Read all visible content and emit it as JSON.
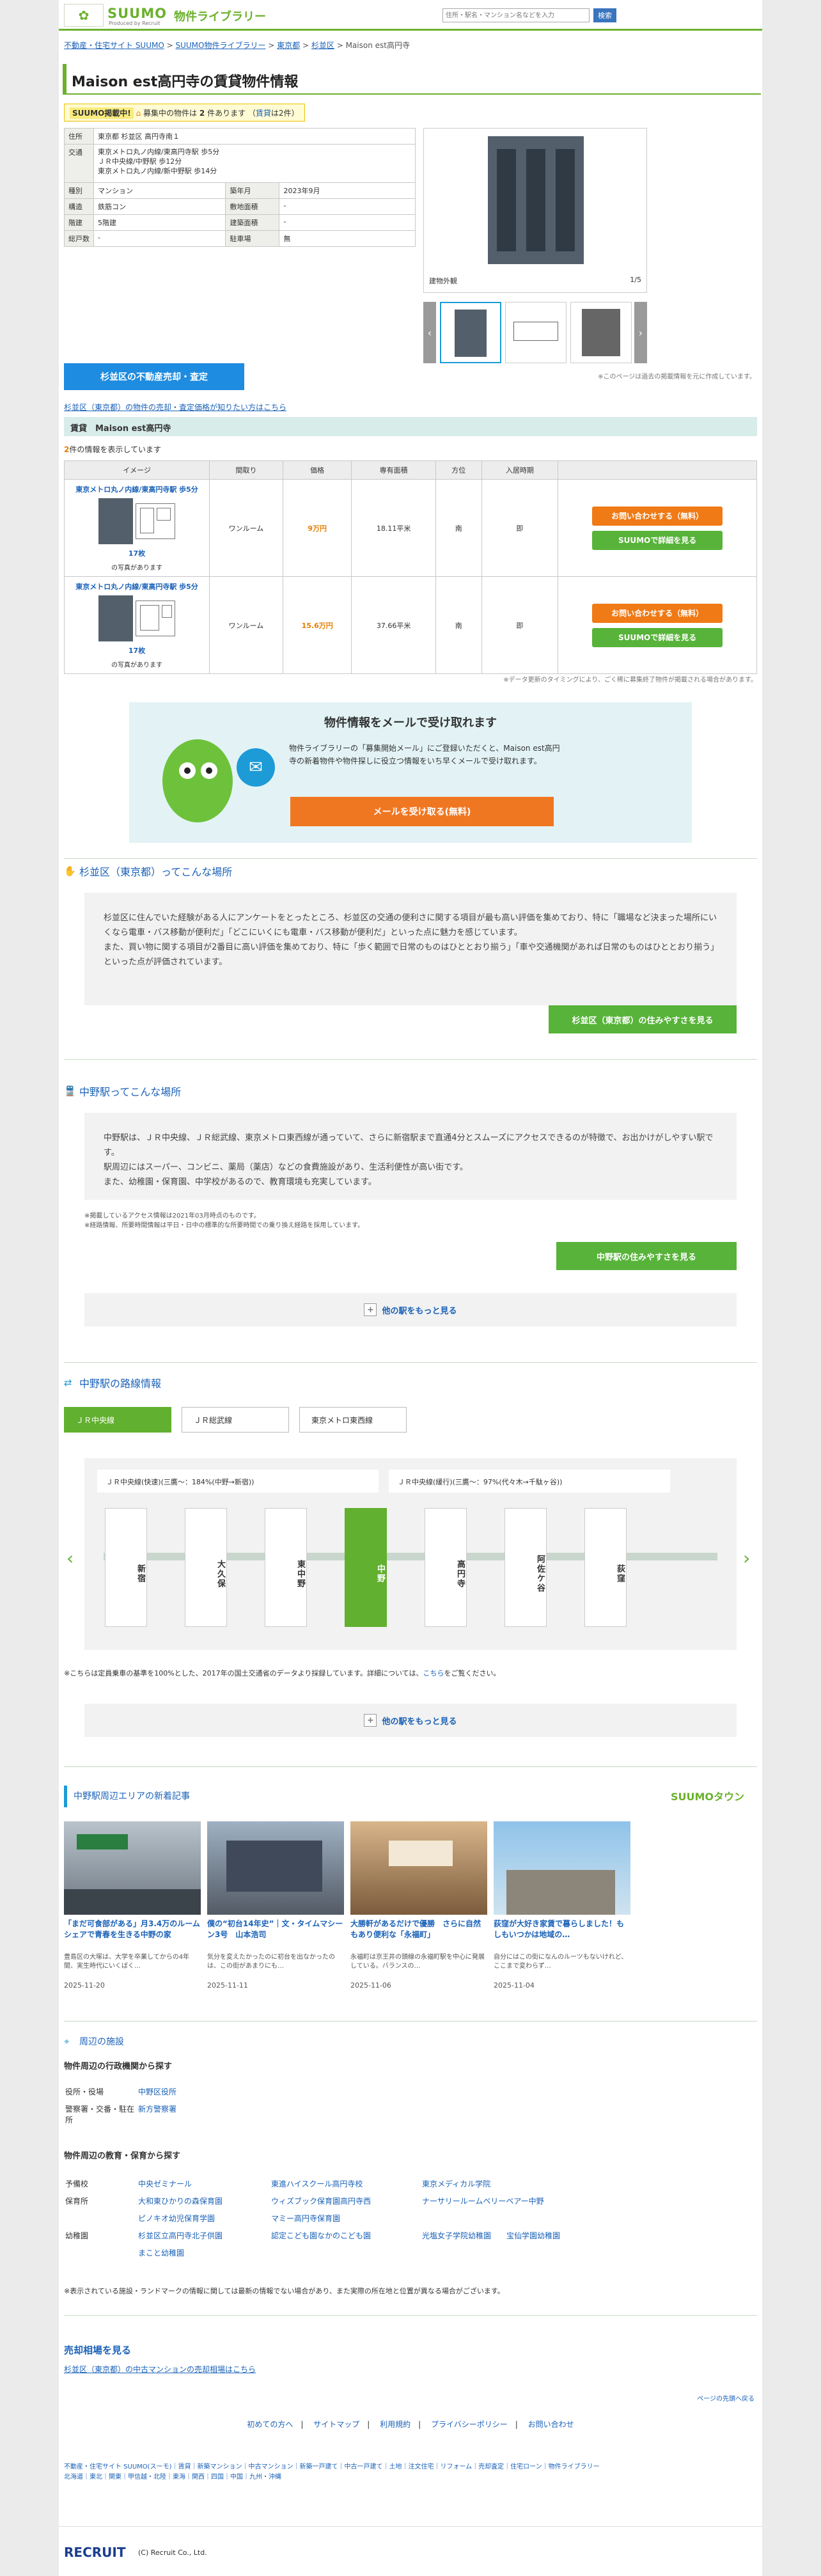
{
  "header": {
    "logo": "SUUMO",
    "logo_sub": "Produced by Recruit",
    "kind": "物件ライブラリー",
    "search_placeholder": "住所・駅名・マンション名などを入力",
    "search_button": "検索"
  },
  "breadcrumb": [
    "不動産・住宅サイト SUUMO",
    "SUUMO物件ライブラリー",
    "東京都",
    "杉並区",
    "Maison est高円寺"
  ],
  "title": "Maison est高円寺の賃貸物件情報",
  "badge": {
    "tag": "SUUMO掲載中!",
    "text1": "募集中の物件は",
    "count": "2",
    "text2": "件あります",
    "link": "賃貸",
    "link_suffix": "は2件"
  },
  "info": [
    {
      "label": "住所",
      "value": "東京都 杉並区 高円寺南１"
    },
    {
      "label": "交通",
      "value": "東京メトロ丸ノ内線/東高円寺駅 歩5分\nＪＲ中央線/中野駅 歩12分\n東京メトロ丸ノ内線/新中野駅 歩14分"
    }
  ],
  "info_grid": [
    {
      "l1": "種別",
      "v1": "マンション",
      "l2": "築年月",
      "v2": "2023年9月"
    },
    {
      "l1": "構造",
      "v1": "鉄筋コン",
      "l2": "敷地面積",
      "v2": "-"
    },
    {
      "l1": "階建",
      "v1": "5階建",
      "l2": "建築面積",
      "v2": "-"
    },
    {
      "l1": "総戸数",
      "v1": "-",
      "l2": "駐車場",
      "v2": "無"
    }
  ],
  "photo": {
    "caption": "建物外観",
    "count": "1/5"
  },
  "photo_note": "※このページは過去の掲載情報を元に作成しています。",
  "sell_button": "杉並区の不動産売却・査定",
  "sell_link": "杉並区（東京都）の物件の売却・査定価格が知りたい方はこちら",
  "rent": {
    "header": "賃貸　Maison est高円寺",
    "count_num": "2",
    "count_text": "件の情報を表示しています",
    "columns": [
      "イメージ",
      "間取り",
      "価格",
      "専有面積",
      "方位",
      "入居時期",
      ""
    ],
    "rows": [
      {
        "name": "東京メトロ丸ノ内線/東高円寺駅 歩5分",
        "pics": "17枚",
        "pics_suffix": "の写真があります",
        "layout": "ワンルーム",
        "price": "9万円",
        "area": "18.11平米",
        "dir": "南",
        "move": "即"
      },
      {
        "name": "東京メトロ丸ノ内線/東高円寺駅 歩5分",
        "pics": "17枚",
        "pics_suffix": "の写真があります",
        "layout": "ワンルーム",
        "price": "15.6万円",
        "area": "37.66平米",
        "dir": "南",
        "move": "即"
      }
    ],
    "btn_inquiry": "お問い合わせする（無料）",
    "btn_detail": "SUUMOで詳細を見る",
    "note": "※データ更新のタイミングにより、ごく稀に募集終了物件が掲載される場合があります。"
  },
  "mail": {
    "title": "物件情報をメールで受け取れます",
    "text": "物件ライブラリーの「募集開始メール」にご登録いただくと、Maison est高円寺の新着物件や物件探しに役立つ情報をいち早くメールで受け取れます。",
    "button": "メールを受け取る(無料)"
  },
  "area1": {
    "title": "杉並区（東京都）ってこんな場所",
    "text": "杉並区に住んでいた経験がある人にアンケートをとったところ、杉並区の交通の便利さに関する項目が最も高い評価を集めており、特に「職場など決まった場所にいくなら電車・バス移動が便利だ」「どこにいくにも電車・バス移動が便利だ」といった点に魅力を感じています。\nまた、買い物に関する項目が2番目に高い評価を集めており、特に「歩く範囲で日常のものはひととおり揃う」「車や交通機関があれば日常のものはひととおり揃う」といった点が評価されています。",
    "button": "杉並区（東京都）の住みやすさを見る"
  },
  "area2": {
    "title": "中野駅ってこんな場所",
    "text": "中野駅は、ＪＲ中央線、ＪＲ総武線、東京メトロ東西線が通っていて、さらに新宿駅まで直通4分とスムーズにアクセスできるのが特徴で、お出かけがしやすい駅です。\n駅周辺にはスーパー、コンビニ、薬局（薬店）などの食費施設があり、生活利便性が高い街です。\nまた、幼稚園・保育園、中学校があるので、教育環境も充実しています。",
    "notes": [
      "※掲載しているアクセス情報は2021年03月時点のものです。",
      "※経路情報、所要時間情報は平日・日中の標準的な所要時間での乗り換え経路を採用しています。"
    ],
    "button": "中野駅の住みやすさを見る",
    "more": "他の駅をもっと見る"
  },
  "lines": {
    "title": "中野駅の路線情報",
    "tabs": [
      "ＪＲ中央線",
      "ＪＲ総武線",
      "東京メトロ東西線"
    ],
    "panel_left": "ＪＲ中央線(快速)(三鷹～：184%(中野→新宿))",
    "panel_right": "ＪＲ中央線(緩行)(三鷹～：97%(代々木→千駄ヶ谷))",
    "stations": [
      "新宿",
      "大久保",
      "東中野",
      "中野",
      "高円寺",
      "阿佐ケ谷",
      "荻窪"
    ],
    "note": "※こちらは定員乗車の基準を100%とした、2017年の国土交通省のデータより採録しています。詳細については、",
    "note_link": "こちら",
    "note_suffix": "をご覧ください。",
    "more": "他の駅をもっと見る"
  },
  "news": {
    "title": "中野駅周辺エリアの新着記事",
    "logo": "SUUMOタウン",
    "items": [
      {
        "title": "「まだ可食部がある」月3.4万のルームシェアで青春を生きる中野の家",
        "desc": "豊島区の大塚は、大学を卒業してからの4年間、実生時代にいくばく…",
        "date": "2025-11-20"
      },
      {
        "title": "僕の“初台14年史”｜文・タイムマシーン3号　山本浩司",
        "desc": "気分を変えたかったのに初台を出なかったのは、この街があまりにも…",
        "date": "2025-11-11"
      },
      {
        "title": "大勝軒があるだけで優勝　さらに自然もあり便利な「永福町」",
        "desc": "永福町は京王井の頭線の永福町駅を中心に発展している。バランスの…",
        "date": "2025-11-06"
      },
      {
        "title": "荻窪が大好き家賃で暮らしました！もしもいつかは地域の…",
        "desc": "自分にはこの街になんのルーツもないけれど、ここまで変わらず…",
        "date": "2025-11-04"
      }
    ]
  },
  "facilities": {
    "title": "周辺の施設",
    "admin_title": "物件周辺の行政機関から探す",
    "admin": [
      {
        "label": "役所・役場",
        "items": [
          "中野区役所"
        ]
      },
      {
        "label": "警察署・交番・駐在所",
        "items": [
          "新方警察署"
        ]
      }
    ],
    "edu_title": "物件周辺の教育・保育から探す",
    "edu": [
      {
        "label": "予備校",
        "items": [
          "中央ゼミナール",
          "東進ハイスクール高円寺校",
          "東京メディカル学院"
        ]
      },
      {
        "label": "保育所",
        "items": [
          "大和東ひかりの森保育園",
          "ウィズブック保育園高円寺西",
          "ナーサリールームベリーベアー中野",
          "ピノキオ幼児保育学園",
          "マミー高円寺保育園"
        ]
      },
      {
        "label": "幼稚園",
        "items": [
          "杉並区立高円寺北子供園",
          "認定こども園なかのこども園",
          "光塩女子学院幼稚園",
          "宝仙学園幼稚園",
          "まこと幼稚園"
        ]
      }
    ],
    "note": "※表示されている施設・ランドマークの情報に関しては最新の情報でない場合があり、また実際の所在地と位置が異なる場合がございます。"
  },
  "sale": {
    "title": "売却相場を見る",
    "link": "杉並区（東京都）の中古マンションの売却相場はこちら"
  },
  "page_top": "ページの先頭へ戻る",
  "footer": {
    "nav": [
      "初めての方へ",
      "サイトマップ",
      "利用規約",
      "プライバシーポリシー",
      "お問い合わせ"
    ],
    "links1": "不動産・住宅サイト SUUMO(スーモ)｜賃貸｜新築マンション｜中古マンション｜新築一戸建て｜中古一戸建て｜土地｜注文住宅｜リフォーム｜売却査定｜住宅ローン｜物件ライブラリー",
    "links2": "北海道｜東北｜関東｜甲信越・北陸｜東海｜関西｜四国｜中国｜九州・沖縄",
    "company": "RECRUIT",
    "copyright": "(C) Recruit Co., Ltd."
  }
}
